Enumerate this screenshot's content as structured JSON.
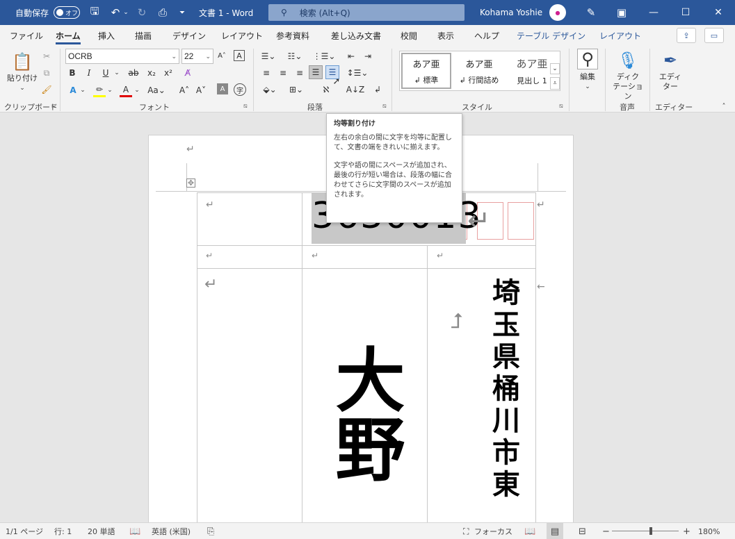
{
  "titlebar": {
    "autosave_label": "自動保存",
    "autosave_state": "オフ",
    "doc_title": "文書 1  -  Word",
    "search_placeholder": "検索 (Alt+Q)",
    "user_name": "Kohama Yoshie"
  },
  "tabs": [
    "ファイル",
    "ホーム",
    "挿入",
    "描画",
    "デザイン",
    "レイアウト",
    "参考資料",
    "差し込み文書",
    "校閲",
    "表示",
    "ヘルプ",
    "テーブル デザイン",
    "レイアウト"
  ],
  "active_tab": "ホーム",
  "ribbon": {
    "clipboard": {
      "paste_label": "貼り付け",
      "group_label": "クリップボード"
    },
    "font": {
      "font_name": "OCRB",
      "font_size": "22",
      "group_label": "フォント"
    },
    "paragraph": {
      "group_label": "段落"
    },
    "styles": {
      "items": [
        {
          "sample": "あア亜",
          "name": "↲ 標準"
        },
        {
          "sample": "あア亜",
          "name": "↲ 行間詰め"
        },
        {
          "sample": "あア亜",
          "name": "見出し 1"
        }
      ],
      "group_label": "スタイル"
    },
    "editing": {
      "label": "編集"
    },
    "voice": {
      "label_line1": "ディク",
      "label_line2": "テーション",
      "group_label": "音声"
    },
    "editor": {
      "label_line1": "エディ",
      "label_line2": "ター",
      "group_label": "エディター"
    }
  },
  "tooltip": {
    "title": "均等割り付け",
    "para1": "左右の余白の間に文字を均等に配置して、文書の端をきれいに揃えます。",
    "para2": "文字や語の間にスペースが追加され、最後の行が短い場合は、段落の幅に合わせてさらに文字間のスペースが追加されます。"
  },
  "document": {
    "zip_visible": "3630013",
    "recipient_text": "大野",
    "address_text": "埼玉県桶川市東"
  },
  "statusbar": {
    "page": "1/1 ページ",
    "line": "行: 1",
    "words": "20 単語",
    "language": "英語 (米国)",
    "focus": "フォーカス",
    "zoom": "180%"
  },
  "colors": {
    "brand": "#2b579a",
    "ribbon_bg": "#f3f3f3",
    "zip_box_border": "#e8a0a0"
  }
}
